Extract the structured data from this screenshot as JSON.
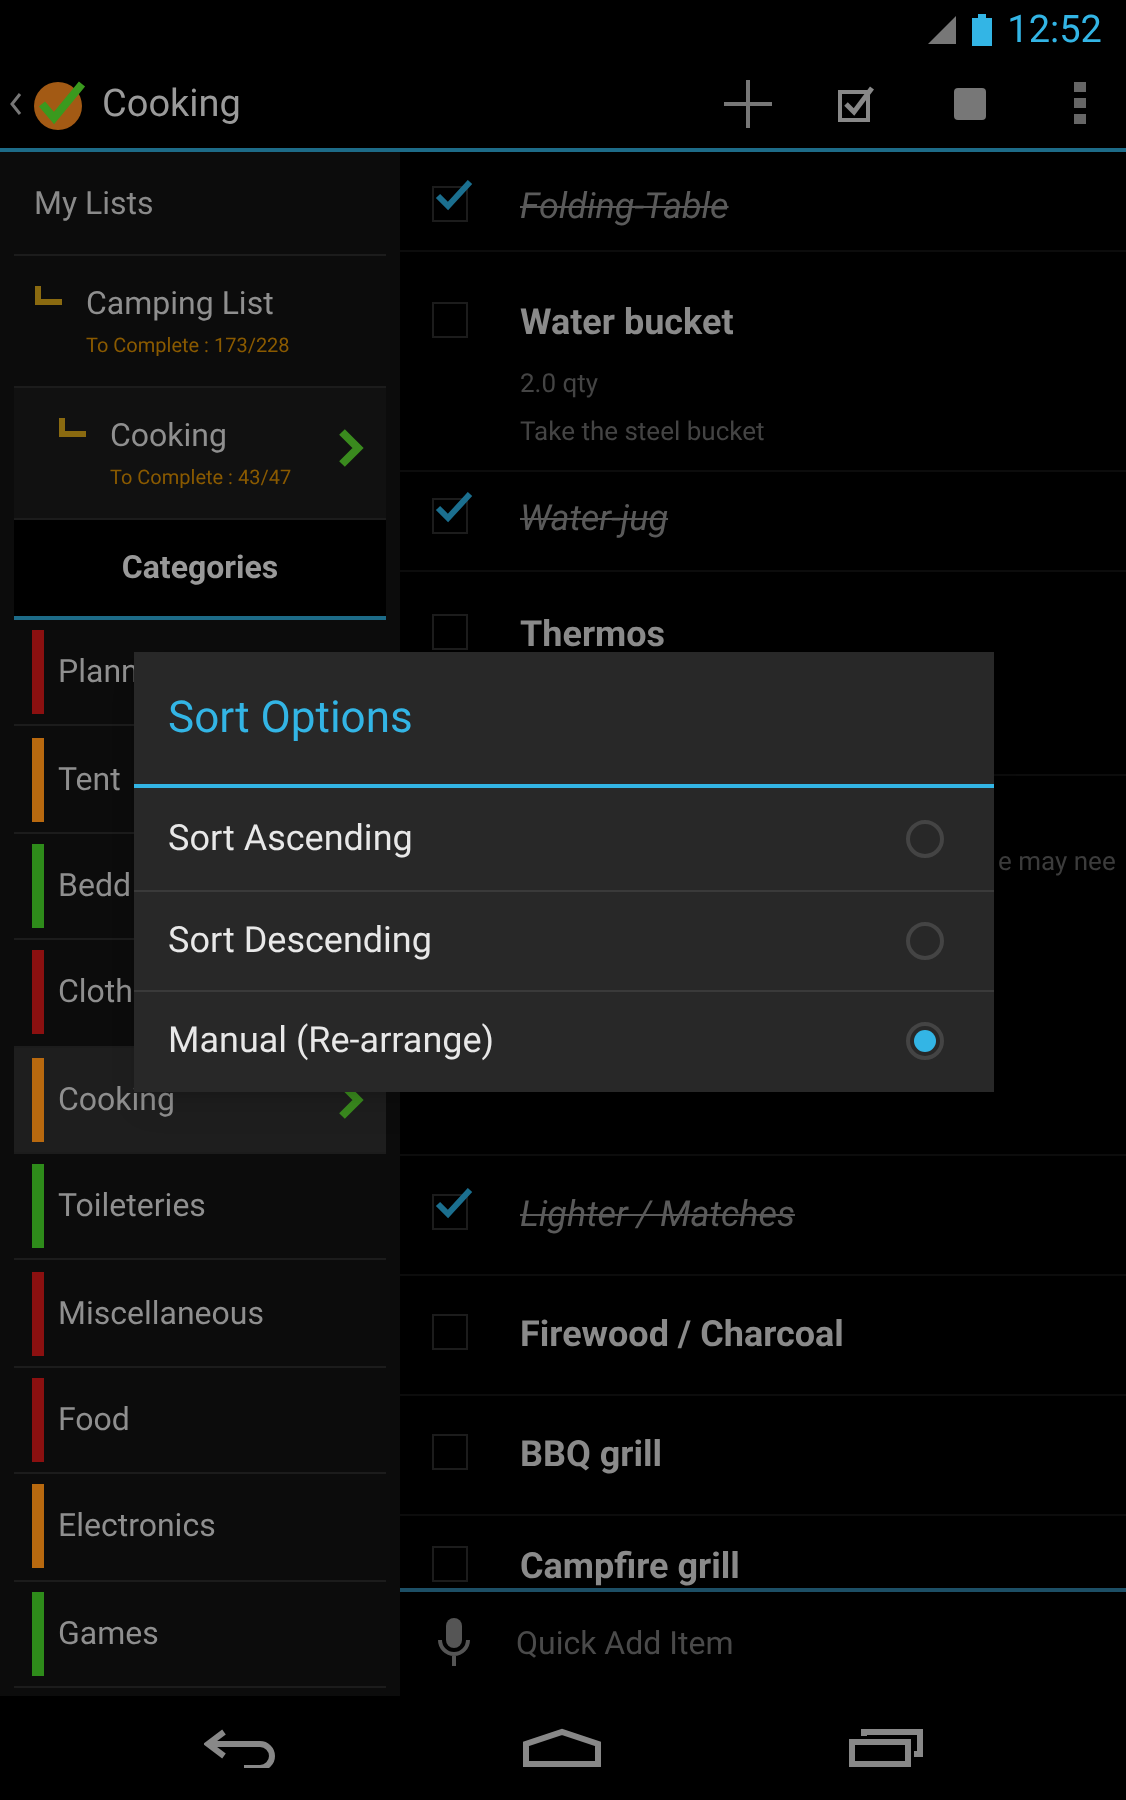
{
  "status_bar": {
    "time": "12:52"
  },
  "action_bar": {
    "title": "Cooking"
  },
  "sidebar": {
    "header": "My Lists",
    "lists": [
      {
        "name": "Camping List",
        "progress": "To Complete : 173/228",
        "selected": false
      },
      {
        "name": "Cooking",
        "progress": "To Complete : 43/47",
        "selected": true
      }
    ],
    "categories_header": "Categories",
    "categories": [
      {
        "name": "Plann",
        "color": "#8b1010",
        "selected": false
      },
      {
        "name": "Tent",
        "color": "#b8690f",
        "selected": false
      },
      {
        "name": "Bedd",
        "color": "#2e8b1a",
        "selected": false
      },
      {
        "name": "Cloth",
        "color": "#8b1010",
        "selected": false
      },
      {
        "name": "Cooking",
        "color": "#b8690f",
        "selected": true
      },
      {
        "name": "Toileteries",
        "color": "#2e8b1a",
        "selected": false
      },
      {
        "name": "Miscellaneous",
        "color": "#8b1010",
        "selected": false
      },
      {
        "name": "Food",
        "color": "#8b1010",
        "selected": false
      },
      {
        "name": "Electronics",
        "color": "#b8690f",
        "selected": false
      },
      {
        "name": "Games",
        "color": "#2e8b1a",
        "selected": false
      }
    ]
  },
  "items": [
    {
      "kind": "item",
      "title": "Folding-Table",
      "checked": true
    },
    {
      "kind": "item",
      "title": "Water bucket",
      "checked": false,
      "qty": "2.0 qty",
      "note": "Take the steel bucket"
    },
    {
      "kind": "item",
      "title": "Water-jug",
      "checked": true
    },
    {
      "kind": "item",
      "title": "Thermos",
      "checked": false
    },
    {
      "kind": "fragment",
      "note": "e may nee"
    },
    {
      "kind": "item"
    },
    {
      "kind": "item",
      "title": "Lighter / Matches",
      "checked": true
    },
    {
      "kind": "item",
      "title": "Firewood / Charcoal",
      "checked": false
    },
    {
      "kind": "item",
      "title": "BBQ grill",
      "checked": false
    },
    {
      "kind": "item",
      "title": "Campfire grill",
      "checked": false
    }
  ],
  "quick_add": {
    "placeholder": "Quick Add Item"
  },
  "dialog": {
    "title": "Sort Options",
    "options": [
      {
        "label": "Sort Ascending",
        "selected": false
      },
      {
        "label": "Sort Descending",
        "selected": false
      },
      {
        "label": "Manual (Re-arrange)",
        "selected": true
      }
    ]
  }
}
